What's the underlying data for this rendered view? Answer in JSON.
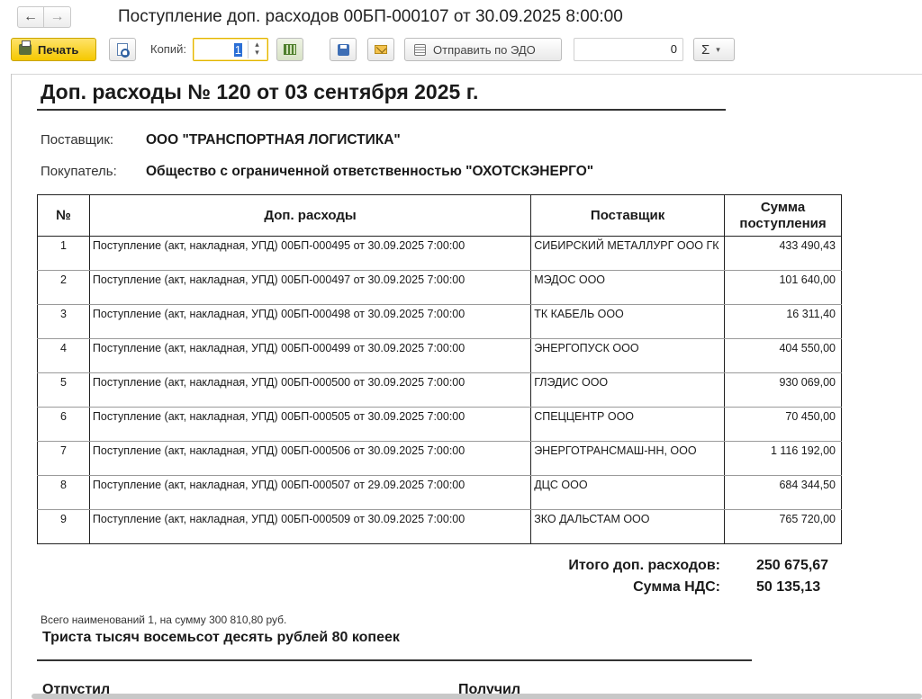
{
  "window": {
    "title": "Поступление доп. расходов 00БП-000107 от 30.09.2025 8:00:00",
    "back_icon": "←",
    "forward_icon": "→"
  },
  "toolbar": {
    "print_label": "Печать",
    "copies_label": "Копий:",
    "copies_value": "1",
    "edo_label": "Отправить по ЭДО",
    "sum_value": "0",
    "sigma_label": "Σ",
    "sigma_caret": "▾",
    "spin_up": "▴",
    "spin_down": "▾"
  },
  "document": {
    "title": "Доп. расходы № 120 от 03 сентября 2025 г.",
    "supplier_label": "Поставщик:",
    "supplier_value": "ООО \"ТРАНСПОРТНАЯ ЛОГИСТИКА\"",
    "buyer_label": "Покупатель:",
    "buyer_value": "Общество с ограниченной ответственностью \"ОХОТСКЭНЕРГО\"",
    "table": {
      "headers": [
        "№",
        "Доп. расходы",
        "Поставщик",
        "Сумма поступления"
      ],
      "rows": [
        {
          "no": "1",
          "desc": "Поступление (акт, накладная, УПД) 00БП-000495 от 30.09.2025 7:00:00",
          "supplier": "СИБИРСКИЙ МЕТАЛЛУРГ ООО ГК",
          "sum": "433 490,43"
        },
        {
          "no": "2",
          "desc": "Поступление (акт, накладная, УПД) 00БП-000497 от 30.09.2025 7:00:00",
          "supplier": "МЭДОС ООО",
          "sum": "101 640,00"
        },
        {
          "no": "3",
          "desc": "Поступление (акт, накладная, УПД) 00БП-000498 от 30.09.2025 7:00:00",
          "supplier": "ТК КАБЕЛЬ ООО",
          "sum": "16 311,40"
        },
        {
          "no": "4",
          "desc": "Поступление (акт, накладная, УПД) 00БП-000499 от 30.09.2025 7:00:00",
          "supplier": "ЭНЕРГОПУСК ООО",
          "sum": "404 550,00"
        },
        {
          "no": "5",
          "desc": "Поступление (акт, накладная, УПД) 00БП-000500 от 30.09.2025 7:00:00",
          "supplier": "ГЛЭДИС ООО",
          "sum": "930 069,00"
        },
        {
          "no": "6",
          "desc": "Поступление (акт, накладная, УПД) 00БП-000505 от 30.09.2025 7:00:00",
          "supplier": "СПЕЦЦЕНТР ООО",
          "sum": "70 450,00"
        },
        {
          "no": "7",
          "desc": "Поступление (акт, накладная, УПД) 00БП-000506 от 30.09.2025 7:00:00",
          "supplier": "ЭНЕРГОТРАНСМАШ-НН, ООО",
          "sum": "1 116 192,00"
        },
        {
          "no": "8",
          "desc": "Поступление (акт, накладная, УПД) 00БП-000507 от 29.09.2025 7:00:00",
          "supplier": "ДЦС ООО",
          "sum": "684 344,50"
        },
        {
          "no": "9",
          "desc": "Поступление (акт, накладная, УПД) 00БП-000509 от 30.09.2025 7:00:00",
          "supplier": "ЗКО ДАЛЬСТАМ ООО",
          "sum": "765 720,00"
        }
      ]
    },
    "totals": {
      "expenses_label": "Итого доп. расходов:",
      "expenses_value": "250 675,67",
      "vat_label": "Сумма НДС:",
      "vat_value": "50 135,13"
    },
    "count_line": "Всего наименований 1, на сумму 300 810,80 руб.",
    "amount_words": "Триста тысяч восемьсот десять рублей 80 копеек",
    "released_label": "Отпустил",
    "received_label": "Получил"
  }
}
